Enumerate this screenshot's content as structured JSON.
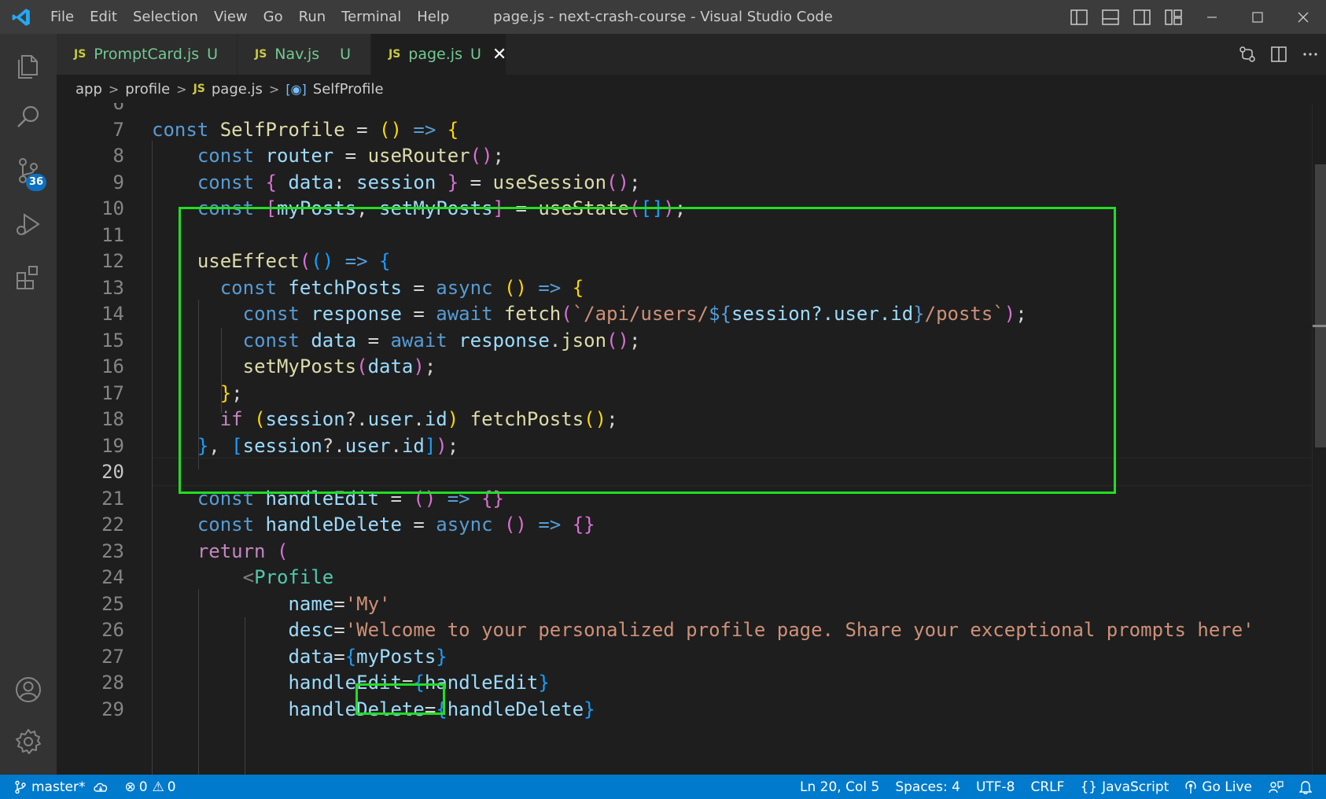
{
  "window": {
    "title": "page.js - next-crash-course - Visual Studio Code",
    "menu": [
      "File",
      "Edit",
      "Selection",
      "View",
      "Go",
      "Run",
      "Terminal",
      "Help"
    ]
  },
  "activity_bar": {
    "items": [
      "explorer-icon",
      "search-icon",
      "source-control-icon",
      "run-debug-icon",
      "extensions-icon"
    ],
    "source_control_badge": "36",
    "bottom_items": [
      "account-icon",
      "settings-gear-icon"
    ]
  },
  "tabs": [
    {
      "label": "PromptCard.js",
      "status": "U",
      "icon": "JS",
      "active": false
    },
    {
      "label": "Nav.js",
      "status": "U",
      "icon": "JS",
      "active": false
    },
    {
      "label": "page.js",
      "status": "U",
      "icon": "JS",
      "active": true
    }
  ],
  "breadcrumb": {
    "parts": [
      "app",
      "profile",
      "page.js",
      "SelfProfile"
    ],
    "js_icon": "JS"
  },
  "editor": {
    "first_line": 6,
    "current_line": 20,
    "lines": [
      "",
      "const SelfProfile = () => {",
      "    const router = useRouter();",
      "    const { data: session } = useSession();",
      "    const [myPosts, setMyPosts] = useState([]);",
      "",
      "    useEffect(() => {",
      "      const fetchPosts = async () => {",
      "        const response = await fetch(`/api/users/${session?.user.id}/posts`);",
      "        const data = await response.json();",
      "        setMyPosts(data);",
      "      };",
      "      if (session?.user.id) fetchPosts();",
      "    }, [session?.user.id]);",
      "",
      "    const handleEdit = () => {}",
      "    const handleDelete = async () => {}",
      "    return (",
      "        <Profile",
      "            name='My'",
      "            desc='Welcome to your personalized profile page. Share your exceptional prompts here'",
      "            data={myPosts}",
      "            handleEdit={handleEdit}",
      "            handleDelete={handleDelete}"
    ]
  },
  "status_bar": {
    "branch": "master*",
    "errors": "0",
    "warnings": "0",
    "cursor": "Ln 20, Col 5",
    "spaces": "Spaces: 4",
    "encoding": "UTF-8",
    "eol": "CRLF",
    "language": "JavaScript",
    "go_live": "Go Live"
  },
  "colors": {
    "accent": "#007acc",
    "highlight_box": "#22dd22",
    "untracked_file": "#73c991"
  }
}
